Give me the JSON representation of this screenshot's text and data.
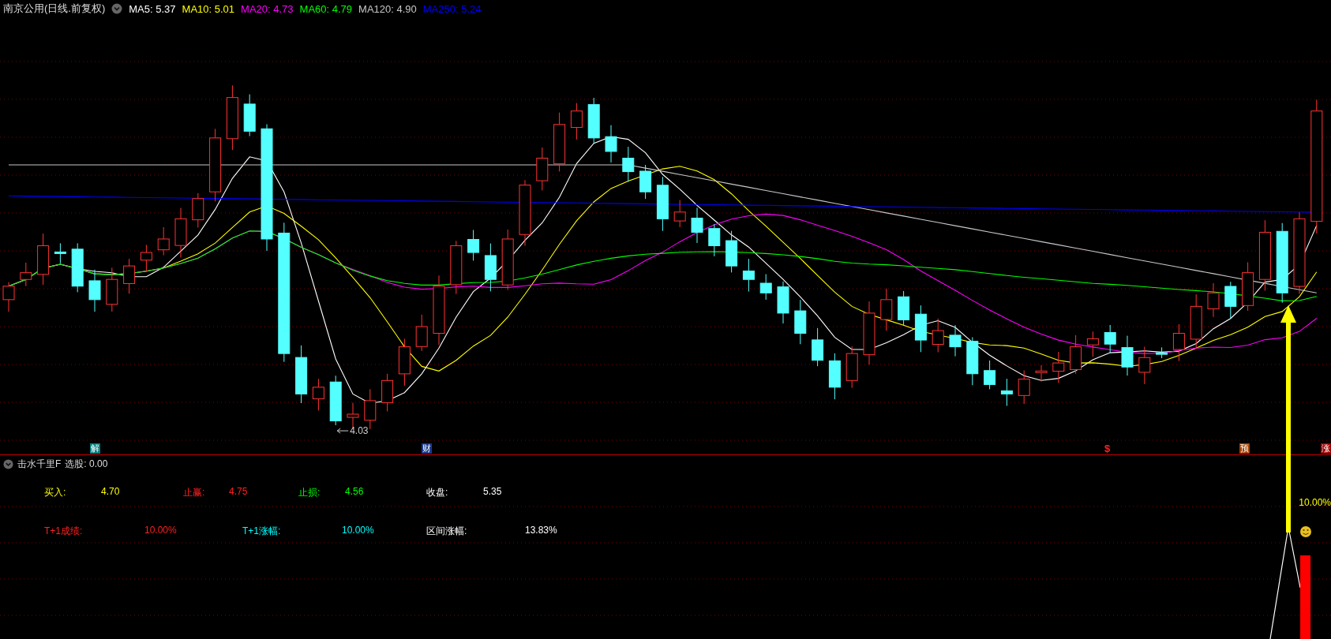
{
  "main_chart": {
    "title": "南京公用(日线.前复权)",
    "indicators": [
      {
        "label": "MA5: 5.37",
        "color": "#ffffff"
      },
      {
        "label": "MA10: 5.01",
        "color": "#ffff00"
      },
      {
        "label": "MA20: 4.73",
        "color": "#ff00ff"
      },
      {
        "label": "MA60: 4.79",
        "color": "#00ff00"
      },
      {
        "label": "MA120: 4.90",
        "color": "#c8c8c8"
      },
      {
        "label": "MA250: 5.24",
        "color": "#0000ff"
      }
    ],
    "low_label": "4.03",
    "markers": [
      {
        "text": "解",
        "kind": "tag",
        "color": "#007f7f"
      },
      {
        "text": "财",
        "kind": "tag",
        "color": "#1c3a8c"
      },
      {
        "text": "$",
        "kind": "symbol",
        "color": "#ff2020"
      },
      {
        "text": "预",
        "kind": "tag",
        "color": "#a04000"
      },
      {
        "text": "涨",
        "kind": "tag",
        "color": "#a00000"
      }
    ]
  },
  "indicator_panel": {
    "title": "击水千里F",
    "selection": "选股: 0.00",
    "stats": [
      [
        {
          "label": "买入:",
          "value": "4.70",
          "color": "#ffff00"
        },
        {
          "label": "止赢:",
          "value": "4.75",
          "color": "#ff2020"
        },
        {
          "label": "止损:",
          "value": "4.56",
          "color": "#00ff00"
        },
        {
          "label": "收盘:",
          "value": "5.35",
          "color": "#ffffff"
        }
      ],
      [
        {
          "label": "T+1成绩:",
          "value": "10.00%",
          "color": "#ff2020"
        },
        {
          "label": "T+1涨幅:",
          "value": "10.00%",
          "color": "#00ffff"
        },
        {
          "label": "区间涨幅:",
          "value": "13.83%",
          "color": "#ffffff"
        }
      ]
    ],
    "signal_value": "10.00%"
  }
}
